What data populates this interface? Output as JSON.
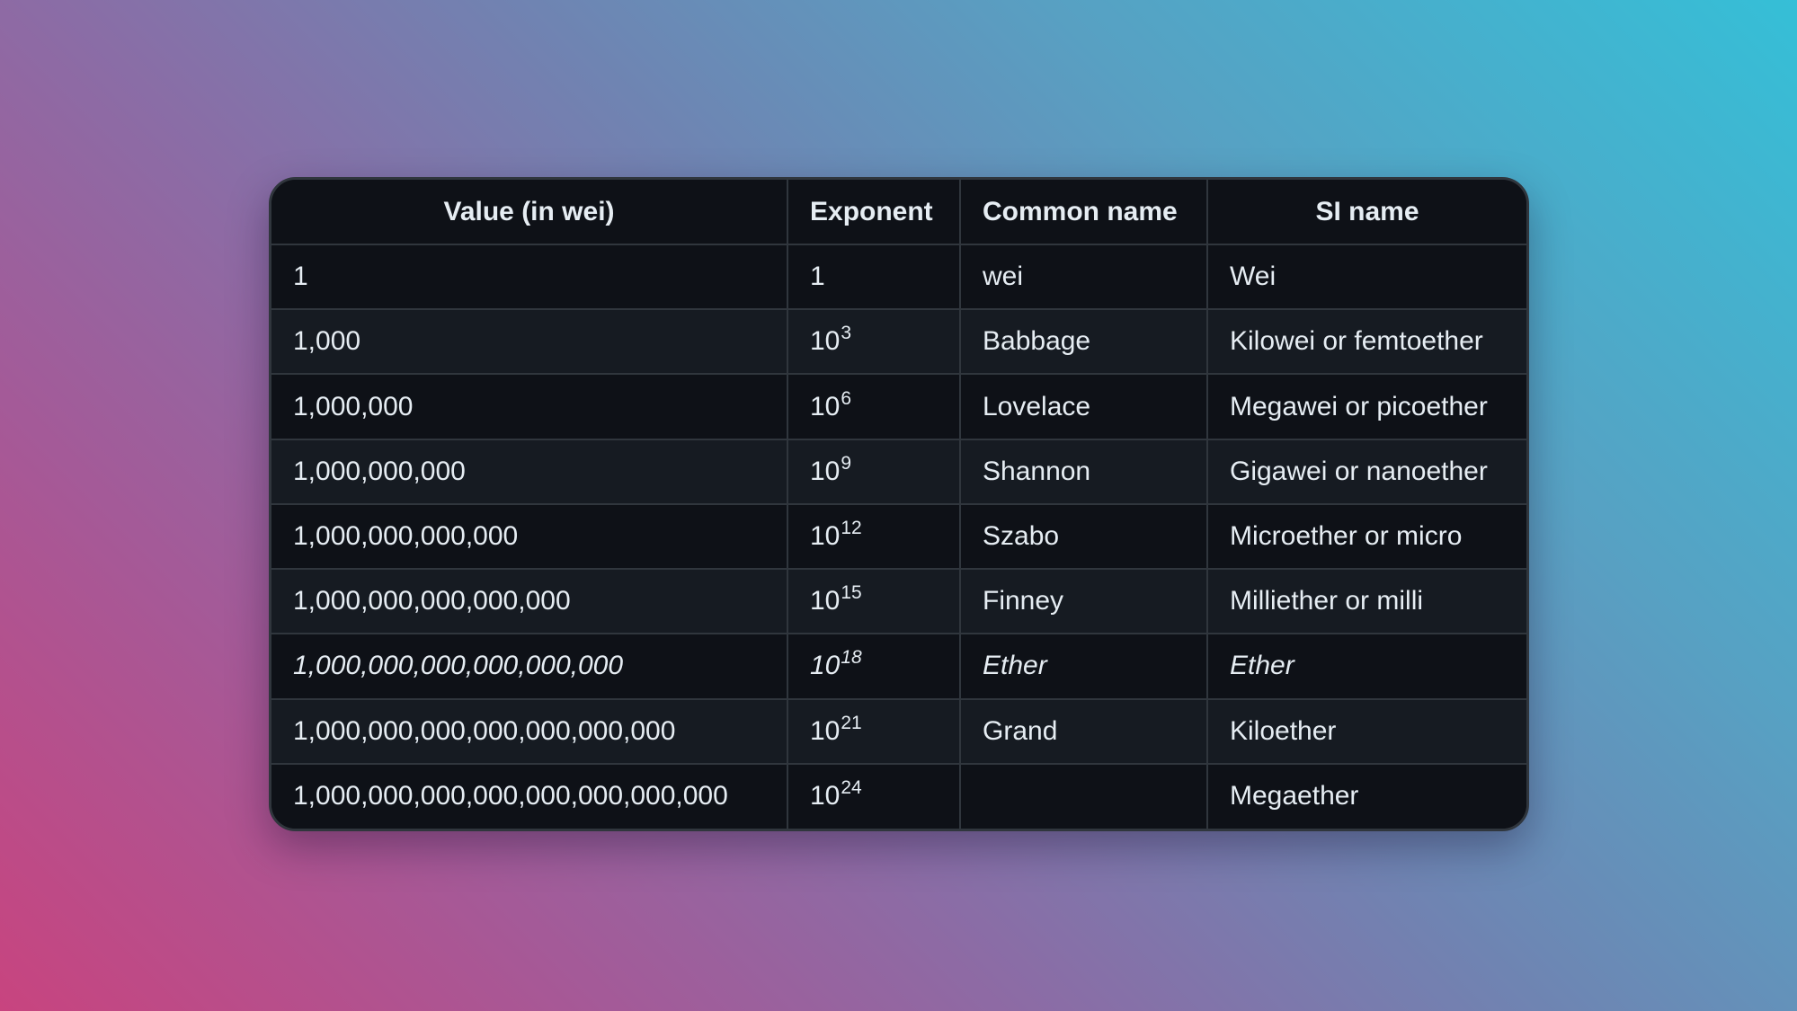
{
  "table": {
    "headers": [
      "Value (in wei)",
      "Exponent",
      "Common name",
      "SI name"
    ],
    "rows": [
      {
        "value": "1",
        "exp_base": "1",
        "exp_power": "",
        "common": "wei",
        "si": "Wei"
      },
      {
        "value": "1,000",
        "exp_base": "10",
        "exp_power": "3",
        "common": "Babbage",
        "si": "Kilowei or femtoether"
      },
      {
        "value": "1,000,000",
        "exp_base": "10",
        "exp_power": "6",
        "common": "Lovelace",
        "si": "Megawei or picoether"
      },
      {
        "value": "1,000,000,000",
        "exp_base": "10",
        "exp_power": "9",
        "common": "Shannon",
        "si": "Gigawei or nanoether"
      },
      {
        "value": "1,000,000,000,000",
        "exp_base": "10",
        "exp_power": "12",
        "common": "Szabo",
        "si": "Microether or micro"
      },
      {
        "value": "1,000,000,000,000,000",
        "exp_base": "10",
        "exp_power": "15",
        "common": "Finney",
        "si": "Milliether or milli"
      },
      {
        "value": "1,000,000,000,000,000,000",
        "exp_base": "10",
        "exp_power": "18",
        "common": "Ether",
        "si": "Ether"
      },
      {
        "value": "1,000,000,000,000,000,000,000",
        "exp_base": "10",
        "exp_power": "21",
        "common": "Grand",
        "si": "Kiloether"
      },
      {
        "value": "1,000,000,000,000,000,000,000,000",
        "exp_base": "10",
        "exp_power": "24",
        "common": "",
        "si": "Megaether"
      }
    ]
  },
  "colors": {
    "table_bg": "#0e1117",
    "row_alt_bg": "#161b22",
    "border": "#30363d",
    "text": "#e6edf3",
    "gradient_start": "#c8447f",
    "gradient_end": "#35bfd7"
  }
}
